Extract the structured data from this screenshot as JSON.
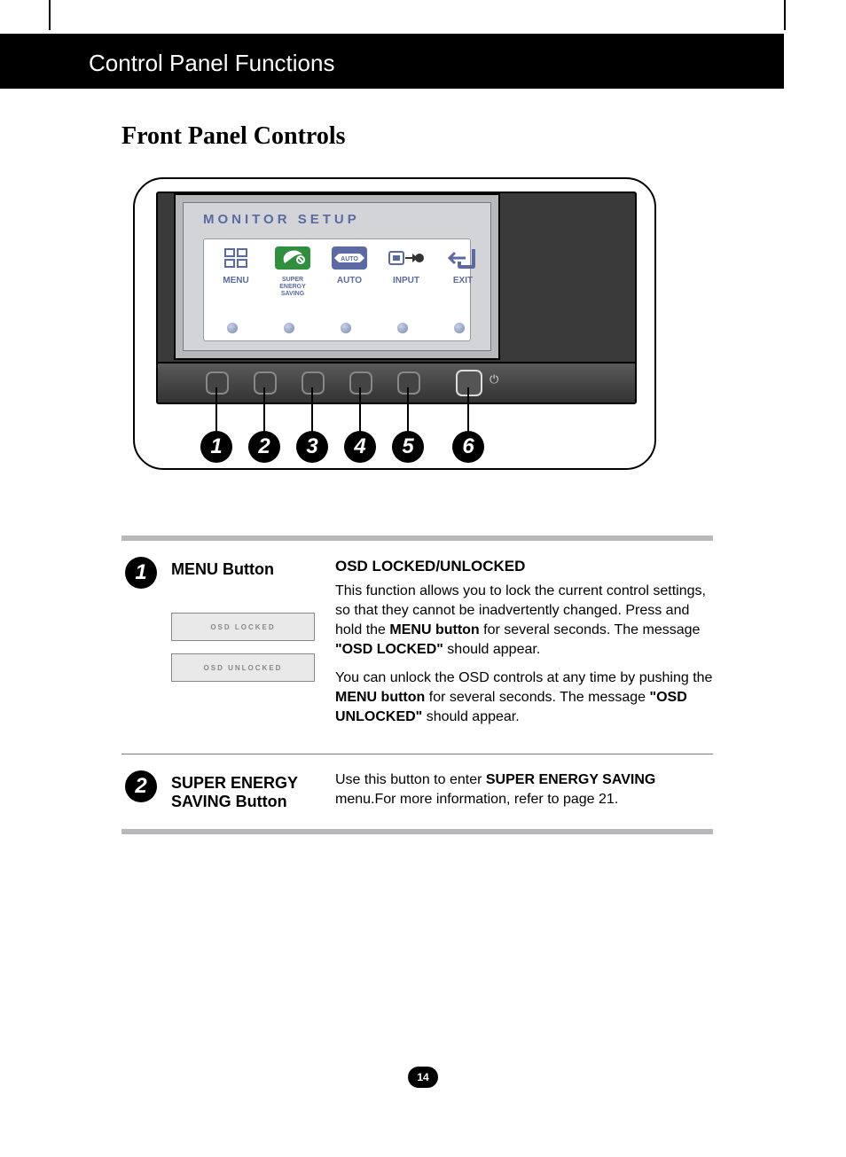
{
  "header": {
    "title": "Control Panel Functions"
  },
  "section": {
    "title": "Front Panel Controls"
  },
  "illustration": {
    "screenTitle": "MONITOR SETUP",
    "osdButtons": [
      {
        "label": "MENU"
      },
      {
        "labelLines": [
          "SUPER",
          "ENERGY",
          "SAVING"
        ]
      },
      {
        "label": "AUTO"
      },
      {
        "label": "INPUT"
      },
      {
        "label": "EXIT"
      }
    ],
    "callouts": [
      "1",
      "2",
      "3",
      "4",
      "5",
      "6"
    ]
  },
  "rows": [
    {
      "num": "1",
      "name": "MENU Button",
      "heading": "OSD LOCKED/UNLOCKED",
      "para1_pre": "This function allows you to lock the current control settings, so that they cannot be inadvertently changed. Press and hold the ",
      "para1_b1": "MENU button",
      "para1_mid": " for several seconds. The message ",
      "para1_b2": "\"OSD LOCKED\"",
      "para1_post": " should appear.",
      "para2_pre": "You can unlock the OSD controls at any time by pushing the ",
      "para2_b1": "MENU button",
      "para2_mid": " for several seconds. The message ",
      "para2_b2": "\"OSD UNLOCKED\"",
      "para2_post": " should appear.",
      "osdImg1": "OSD LOCKED",
      "osdImg2": "OSD UNLOCKED"
    },
    {
      "num": "2",
      "name": "SUPER ENERGY SAVING Button",
      "desc_pre": "Use this button to enter ",
      "desc_b1": "SUPER ENERGY SAVING",
      "desc_post": " menu.For more information, refer to page 21."
    }
  ],
  "pageNumber": "14"
}
